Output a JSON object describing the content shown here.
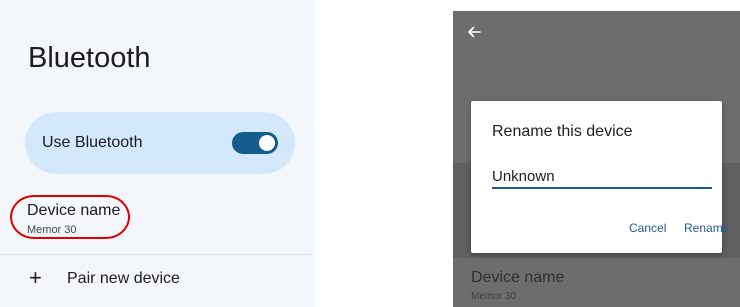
{
  "left": {
    "title": "Bluetooth",
    "toggle": {
      "label": "Use Bluetooth",
      "enabled": true
    },
    "device": {
      "title": "Device name",
      "value": "Memor 30"
    },
    "pair": {
      "label": "Pair new device",
      "icon": "plus-icon"
    }
  },
  "right": {
    "back_icon": "arrow-left-icon",
    "dialog": {
      "title": "Rename this device",
      "input_value": "Unknown",
      "cancel_label": "Cancel",
      "rename_label": "Rename"
    },
    "background": {
      "device_title": "Device name",
      "device_value": "Memor 30"
    }
  },
  "colors": {
    "accent": "#1f5a99",
    "switch_on": "#145c8c",
    "toggle_card": "#d3e9fb",
    "highlight": "#e00000",
    "scrim": "#6d6d6d"
  }
}
